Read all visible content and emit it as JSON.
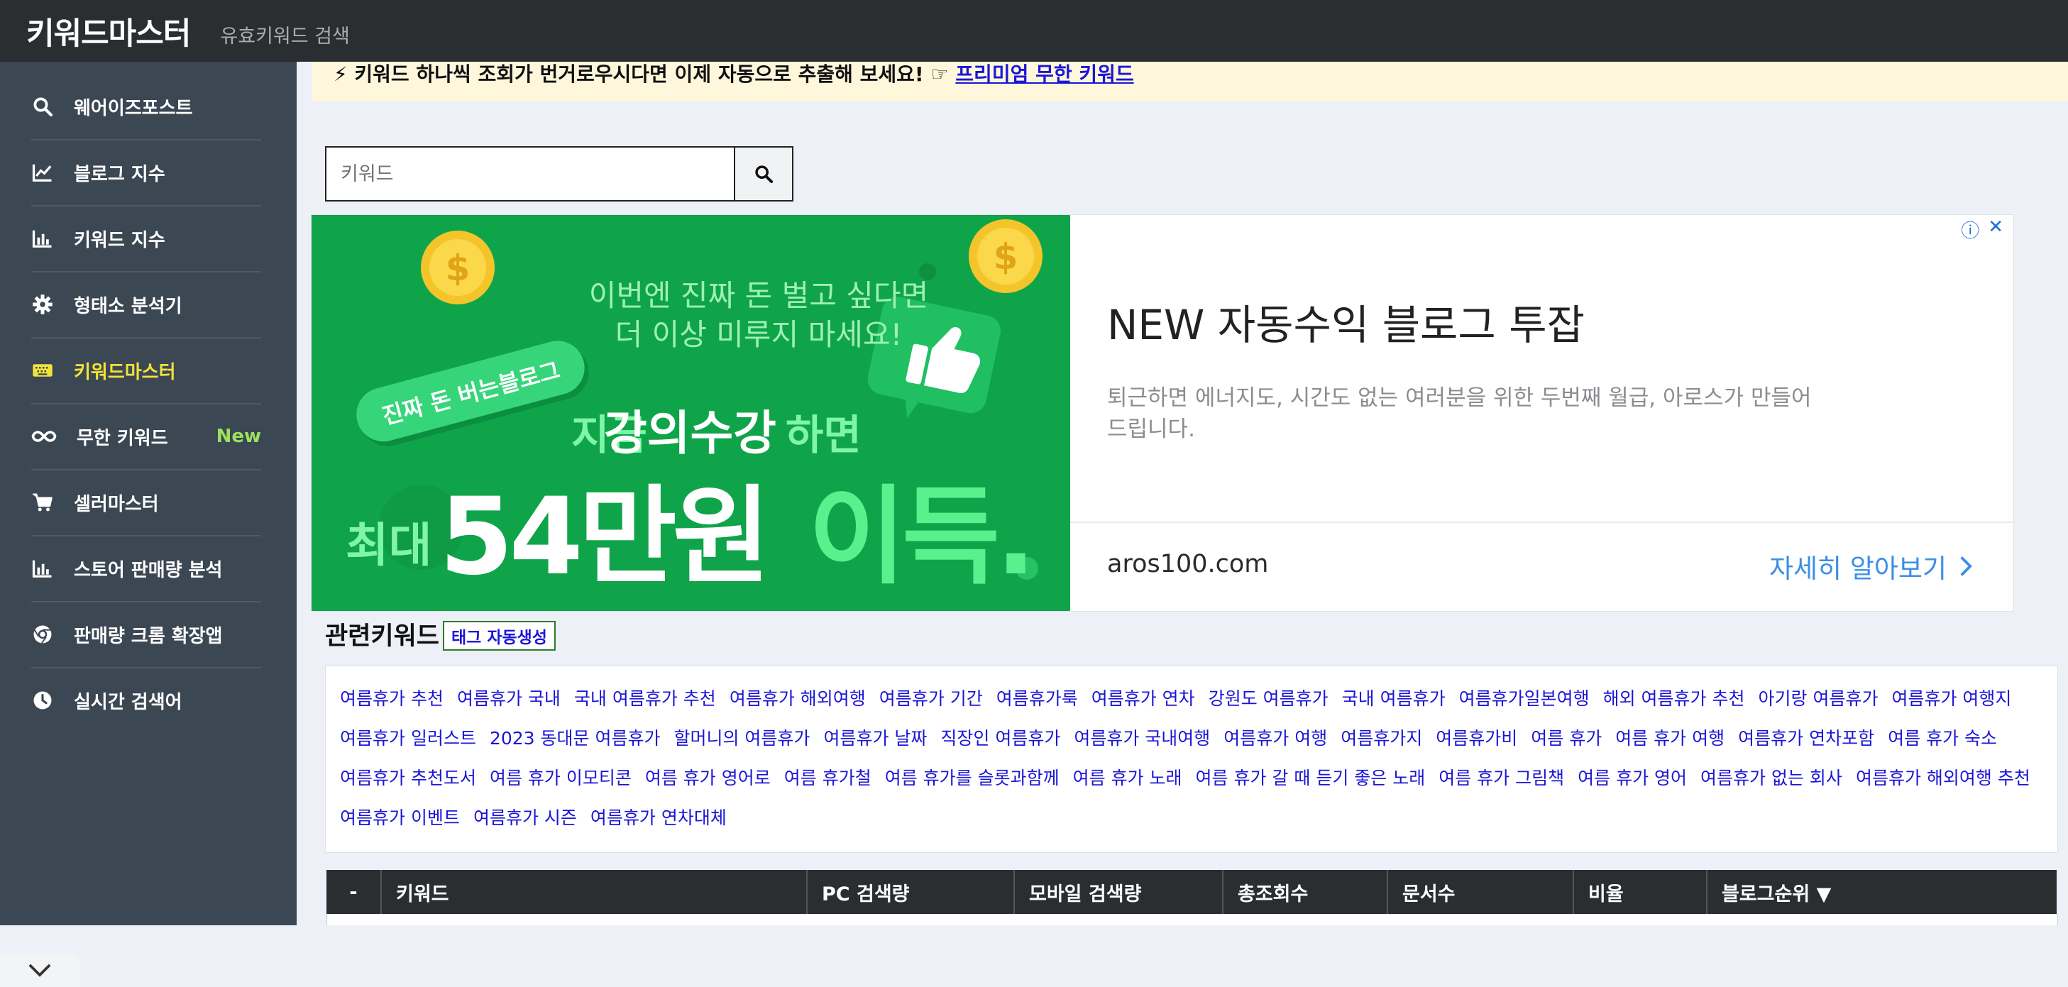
{
  "header": {
    "brand": "키워드마스터",
    "subtitle": "유효키워드 검색"
  },
  "sidebar": {
    "items": [
      {
        "label": "웨어이즈포스트",
        "icon": "search-icon"
      },
      {
        "label": "블로그 지수",
        "icon": "line-chart-icon"
      },
      {
        "label": "키워드 지수",
        "icon": "bar-chart-icon"
      },
      {
        "label": "형태소 분석기",
        "icon": "gear-icon"
      },
      {
        "label": "키워드마스터",
        "icon": "keyboard-icon",
        "active": true
      },
      {
        "label": "무한 키워드",
        "icon": "infinity-icon",
        "badge": "New"
      },
      {
        "label": "셀러마스터",
        "icon": "cart-icon"
      },
      {
        "label": "스토어 판매량 분석",
        "icon": "bar-chart-icon"
      },
      {
        "label": "판매량 크롬 확장앱",
        "icon": "chrome-icon"
      },
      {
        "label": "실시간 검색어",
        "icon": "clock-icon"
      }
    ]
  },
  "notice": {
    "text": "⚡ 키워드 하나씩 조회가 번거로우시다면 이제 자동으로 추출해 보세요! ☞ ",
    "link": "프리미엄 무한 키워드"
  },
  "search": {
    "placeholder": "키워드",
    "value": ""
  },
  "ad": {
    "image_lines": {
      "top1": "이번엔 진짜 돈 벌고 싶다면",
      "top2": "더 이상 미루지 마세요!",
      "badge": "진짜 돈 버는블로그",
      "mid_a": "지금",
      "mid_b": "강의수강",
      "mid_c": "하면",
      "big_a": "최대",
      "big_b": "54만원",
      "big_c": "이득."
    },
    "title": "NEW 자동수익 블로그 투잡",
    "description": "퇴근하면 에너지도, 시간도 없는 여러분을 위한 두번째 월급, 아로스가 만들어드립니다.",
    "domain": "aros100.com",
    "cta": "자세히 알아보기"
  },
  "related": {
    "title": "관련키워드",
    "tag_button": "태그 자동생성",
    "lines": [
      [
        "여름휴가 추천",
        "여름휴가 국내",
        "국내 여름휴가 추천",
        "여름휴가 해외여행",
        "여름휴가 기간",
        "여름휴가룩",
        "여름휴가 연차",
        "강원도 여름휴가",
        "국내 여름휴가",
        "여름휴가일본여행",
        "해외 여름휴가 추천",
        "아기랑 여름휴가",
        "여름휴가 여행지"
      ],
      [
        "여름휴가 일러스트",
        "2023 동대문 여름휴가",
        "할머니의 여름휴가",
        "여름휴가 날짜",
        "직장인 여름휴가",
        "여름휴가 국내여행",
        "여름휴가 여행",
        "여름휴가지",
        "여름휴가비",
        "여름 휴가",
        "여름 휴가 여행",
        "여름휴가 연차포함",
        "여름 휴가 숙소"
      ],
      [
        "여름휴가 추천도서",
        "여름 휴가 이모티콘",
        "여름 휴가 영어로",
        "여름 휴가철",
        "여름 휴가를 슬롯과함께",
        "여름 휴가 노래",
        "여름 휴가 갈 때 듣기 좋은 노래",
        "여름 휴가 그림책",
        "여름 휴가 영어",
        "여름휴가 없는 회사",
        "여름휴가 해외여행 추천"
      ],
      [
        "여름휴가 이벤트",
        "여름휴가 시즌",
        "여름휴가 연차대체"
      ]
    ]
  },
  "table": {
    "headers": [
      "-",
      "키워드",
      "PC 검색량",
      "모바일 검색량",
      "총조회수",
      "문서수",
      "비율",
      "블로그순위 ▼"
    ]
  }
}
